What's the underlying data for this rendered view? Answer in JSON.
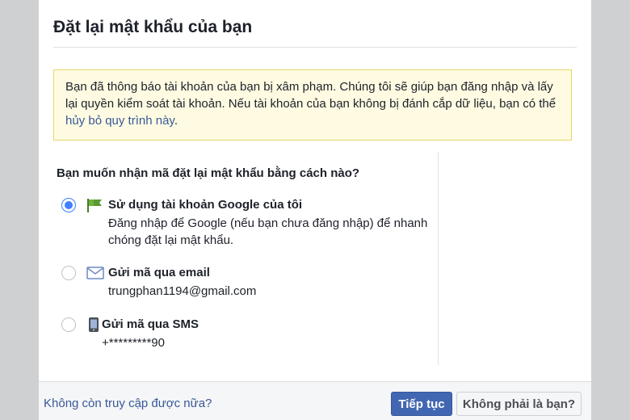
{
  "dialog": {
    "title": "Đặt lại mật khẩu của bạn"
  },
  "notice": {
    "text": "Bạn đã thông báo tài khoản của bạn bị xâm phạm. Chúng tôi sẽ giúp bạn đăng nhập và lấy lại quyền kiểm soát tài khoản. Nếu tài khoản của bạn không bị đánh cắp dữ liệu, bạn có thể ",
    "link": "hủy bỏ quy trình này",
    "suffix": "."
  },
  "question": "Bạn muốn nhận mã đặt lại mật khẩu bằng cách nào?",
  "options": [
    {
      "title": "Sử dụng tài khoản Google của tôi",
      "desc_line1": "Đăng nhập để Google (nếu bạn chưa đăng nhập) để nhanh",
      "desc_line2": "chóng đặt lại mật khẩu.",
      "icon": "google-flag-icon",
      "selected": true
    },
    {
      "title": "Gửi mã qua email",
      "desc_line1": "trungphan1194@gmail.com",
      "icon": "email-icon",
      "selected": false
    },
    {
      "title": "Gửi mã qua SMS",
      "desc_line1": "+*********90",
      "icon": "phone-icon",
      "selected": false
    }
  ],
  "footer": {
    "link": "Không còn truy cập được nữa?",
    "continue_label": "Tiếp tục",
    "not_you_label": "Không phải là bạn?"
  },
  "colors": {
    "accent": "#4267b2",
    "link": "#385898",
    "radio": "#4080ff",
    "notice_bg": "#fffbe2",
    "notice_border": "#e7d768"
  }
}
